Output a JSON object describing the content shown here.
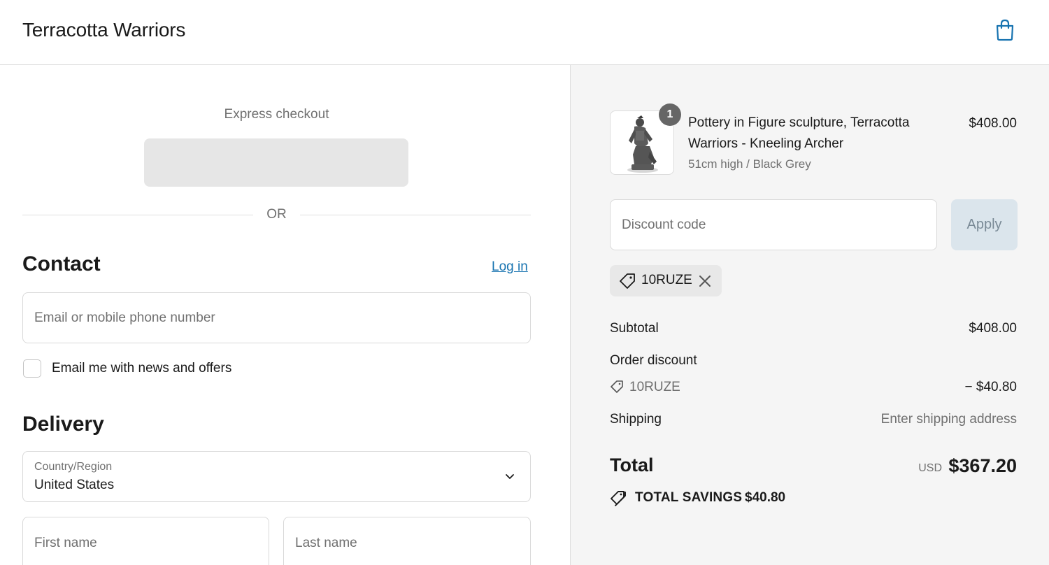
{
  "header": {
    "store_name": "Terracotta Warriors",
    "cart_icon": "shopping-bag-icon"
  },
  "express": {
    "label": "Express checkout",
    "or_text": "OR"
  },
  "contact": {
    "title": "Contact",
    "login_label": "Log in",
    "email_placeholder": "Email or mobile phone number",
    "newsletter_label": "Email me with news and offers"
  },
  "delivery": {
    "title": "Delivery",
    "country_label": "Country/Region",
    "country_value": "United States",
    "first_name_placeholder": "First name",
    "last_name_placeholder": "Last name"
  },
  "order": {
    "item": {
      "quantity": "1",
      "name": "Pottery in Figure sculpture, Terracotta Warriors - Kneeling Archer",
      "variant": "51cm high / Black Grey",
      "price": "$408.00",
      "image_icon": "warrior-statue-image"
    },
    "discount_placeholder": "Discount code",
    "apply_label": "Apply",
    "applied_code": "10RUZE",
    "subtotal_label": "Subtotal",
    "subtotal_value": "$408.00",
    "order_discount_label": "Order discount",
    "discount_code": "10RUZE",
    "discount_value": "− $40.80",
    "shipping_label": "Shipping",
    "shipping_value": "Enter shipping address",
    "total_label": "Total",
    "currency": "USD",
    "total_value": "$367.20",
    "savings_label": "TOTAL SAVINGS",
    "savings_value": "$40.80"
  },
  "colors": {
    "link": "#1773b0",
    "summary_bg": "#f5f5f5",
    "apply_bg": "#dbe5ec"
  }
}
